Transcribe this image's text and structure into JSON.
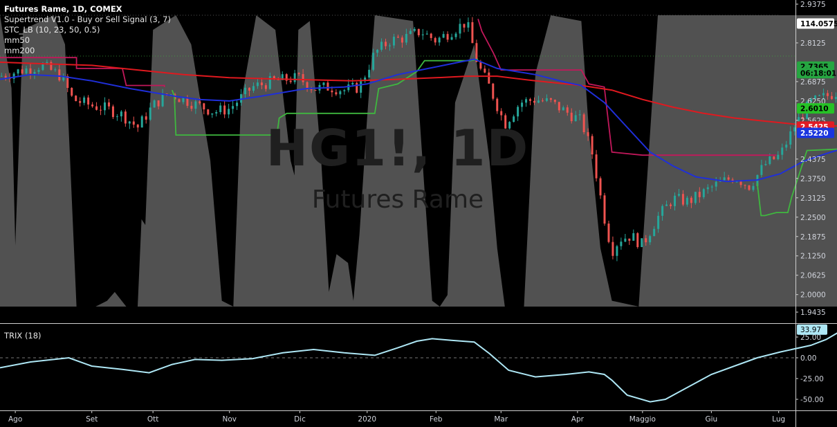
{
  "header": {
    "symbol_line": "Futures Rame, 1D, COMEX",
    "indicators": [
      "Supertrend V1.0 - Buy or Sell Signal (3, 7)",
      "STC_LB (10, 23, 50, 0.5)",
      "mm50",
      "mm200"
    ],
    "lower_indicator": "TRIX (18)"
  },
  "watermark": {
    "symbol": "HG1!, 1D",
    "description": "Futures Rame"
  },
  "price_axis": {
    "ticks": [
      "2.9375",
      "2.8125",
      "2.6875",
      "2.6250",
      "2.5625",
      "2.4375",
      "2.3750",
      "2.3125",
      "2.2500",
      "2.1875",
      "2.1250",
      "2.0625",
      "2.0000",
      "1.9435"
    ],
    "tick_values": [
      2.9375,
      2.8125,
      2.6875,
      2.625,
      2.5625,
      2.4375,
      2.375,
      2.3125,
      2.25,
      2.1875,
      2.125,
      2.0625,
      2.0,
      1.9435
    ],
    "badges": [
      {
        "label": "114.0575",
        "value": 2.875,
        "bg": "#ffffff",
        "fg": "#000000"
      },
      {
        "label": "2.7365",
        "value": 2.736,
        "bg": "#26a641",
        "fg": "#000000"
      },
      {
        "label": "06:18:01",
        "value": 2.715,
        "bg": "#26a641",
        "fg": "#000000"
      },
      {
        "label": "2.6010",
        "value": 2.601,
        "bg": "#26c226",
        "fg": "#000000"
      },
      {
        "label": "2.5425",
        "value": 2.5425,
        "bg": "#e01b24",
        "fg": "#ffffff"
      },
      {
        "label": "2.5220",
        "value": 2.522,
        "bg": "#1a35e0",
        "fg": "#ffffff"
      }
    ]
  },
  "trix_axis": {
    "ticks": [
      "25.00",
      "0.00",
      "-25.00",
      "-50.00"
    ],
    "tick_values": [
      25,
      0,
      -25,
      -50
    ],
    "badge": {
      "label": "33.97",
      "value": 33.97,
      "bg": "#aee7f5",
      "fg": "#000000"
    }
  },
  "time_axis": {
    "labels": [
      "Ago",
      "Set",
      "Ott",
      "Nov",
      "Dic",
      "2020",
      "Feb",
      "Mar",
      "Apr",
      "Maggio",
      "Giu",
      "Lug"
    ],
    "label_days": [
      20,
      120,
      200,
      300,
      392,
      480,
      570,
      655,
      755,
      840,
      930,
      1018
    ],
    "total_days": 1040
  },
  "colors": {
    "background": "#000000",
    "bull_candle": "#26a69a",
    "bear_candle": "#ef5350",
    "stc_fill": "#5a5a5a",
    "supertrend_up": "#3fb83f",
    "supertrend_down": "#c2185b",
    "mm50": "#1f2fd9",
    "mm200": "#e0191f",
    "trix": "#aee7f5"
  },
  "chart_data": {
    "type": "candlestick",
    "x_unit": "days from chart start",
    "price_close_path": [
      [
        0,
        2.705
      ],
      [
        30,
        2.725
      ],
      [
        55,
        2.74
      ],
      [
        80,
        2.705
      ],
      [
        95,
        2.63
      ],
      [
        120,
        2.61
      ],
      [
        140,
        2.6
      ],
      [
        160,
        2.58
      ],
      [
        180,
        2.54
      ],
      [
        200,
        2.61
      ],
      [
        220,
        2.65
      ],
      [
        250,
        2.62
      ],
      [
        280,
        2.59
      ],
      [
        300,
        2.6
      ],
      [
        330,
        2.67
      ],
      [
        360,
        2.69
      ],
      [
        390,
        2.7
      ],
      [
        410,
        2.665
      ],
      [
        430,
        2.67
      ],
      [
        450,
        2.66
      ],
      [
        470,
        2.67
      ],
      [
        490,
        2.78
      ],
      [
        510,
        2.82
      ],
      [
        530,
        2.83
      ],
      [
        550,
        2.85
      ],
      [
        570,
        2.82
      ],
      [
        590,
        2.85
      ],
      [
        610,
        2.88
      ],
      [
        625,
        2.74
      ],
      [
        640,
        2.67
      ],
      [
        660,
        2.55
      ],
      [
        680,
        2.62
      ],
      [
        700,
        2.63
      ],
      [
        720,
        2.62
      ],
      [
        740,
        2.59
      ],
      [
        760,
        2.56
      ],
      [
        775,
        2.45
      ],
      [
        790,
        2.25
      ],
      [
        800,
        2.14
      ],
      [
        810,
        2.18
      ],
      [
        825,
        2.19
      ],
      [
        840,
        2.16
      ],
      [
        860,
        2.25
      ],
      [
        880,
        2.31
      ],
      [
        900,
        2.3
      ],
      [
        920,
        2.33
      ],
      [
        940,
        2.36
      ],
      [
        960,
        2.38
      ],
      [
        980,
        2.35
      ],
      [
        1000,
        2.42
      ],
      [
        1020,
        2.45
      ],
      [
        1040,
        2.55
      ],
      [
        1060,
        2.62
      ],
      [
        1080,
        2.64
      ],
      [
        1100,
        2.66
      ],
      [
        1120,
        2.7365
      ]
    ],
    "stc_values": [
      [
        0,
        100
      ],
      [
        15,
        75
      ],
      [
        20,
        21
      ],
      [
        30,
        95
      ],
      [
        70,
        100
      ],
      [
        85,
        90
      ],
      [
        100,
        0
      ],
      [
        125,
        0
      ],
      [
        140,
        2
      ],
      [
        150,
        5
      ],
      [
        165,
        0
      ],
      [
        180,
        0
      ],
      [
        185,
        30
      ],
      [
        190,
        28
      ],
      [
        200,
        95
      ],
      [
        230,
        100
      ],
      [
        250,
        90
      ],
      [
        275,
        50
      ],
      [
        290,
        2
      ],
      [
        305,
        0
      ],
      [
        315,
        70
      ],
      [
        335,
        100
      ],
      [
        360,
        95
      ],
      [
        380,
        50
      ],
      [
        385,
        45
      ],
      [
        390,
        95
      ],
      [
        405,
        98
      ],
      [
        420,
        50
      ],
      [
        430,
        5
      ],
      [
        440,
        18
      ],
      [
        455,
        15
      ],
      [
        462,
        2
      ],
      [
        470,
        25
      ],
      [
        480,
        65
      ],
      [
        490,
        100
      ],
      [
        540,
        98
      ],
      [
        555,
        40
      ],
      [
        565,
        2
      ],
      [
        575,
        0
      ],
      [
        585,
        4
      ],
      [
        595,
        70
      ],
      [
        620,
        90
      ],
      [
        640,
        50
      ],
      [
        650,
        20
      ],
      [
        660,
        0
      ],
      [
        685,
        0
      ],
      [
        700,
        80
      ],
      [
        720,
        100
      ],
      [
        760,
        98
      ],
      [
        770,
        60
      ],
      [
        785,
        20
      ],
      [
        800,
        2
      ],
      [
        835,
        0
      ],
      [
        860,
        100
      ],
      [
        1125,
        100
      ]
    ],
    "supertrend_segments": [
      {
        "dir": "down",
        "points": [
          [
            0,
            2.765
          ],
          [
            100,
            2.765
          ],
          [
            100,
            2.73
          ],
          [
            160,
            2.73
          ],
          [
            165,
            2.675
          ],
          [
            215,
            2.675
          ],
          [
            215,
            2.67
          ]
        ]
      },
      {
        "dir": "up",
        "points": [
          [
            225,
            2.66
          ],
          [
            228,
            2.64
          ],
          [
            230,
            2.515
          ],
          [
            362,
            2.515
          ],
          [
            365,
            2.57
          ],
          [
            375,
            2.585
          ],
          [
            490,
            2.585
          ],
          [
            495,
            2.665
          ],
          [
            520,
            2.68
          ],
          [
            545,
            2.72
          ],
          [
            555,
            2.755
          ],
          [
            615,
            2.755
          ],
          [
            625,
            2.76
          ]
        ]
      },
      {
        "dir": "down",
        "points": [
          [
            625,
            2.89
          ],
          [
            630,
            2.85
          ],
          [
            645,
            2.78
          ],
          [
            655,
            2.725
          ],
          [
            760,
            2.725
          ],
          [
            770,
            2.68
          ],
          [
            790,
            2.67
          ],
          [
            800,
            2.46
          ],
          [
            840,
            2.45
          ],
          [
            1015,
            2.45
          ]
        ]
      },
      {
        "dir": "up",
        "points": [
          [
            990,
            2.36
          ],
          [
            995,
            2.255
          ],
          [
            1000,
            2.255
          ],
          [
            1015,
            2.265
          ],
          [
            1030,
            2.265
          ],
          [
            1035,
            2.315
          ],
          [
            1055,
            2.465
          ],
          [
            1100,
            2.47
          ],
          [
            1112,
            2.49
          ],
          [
            1125,
            2.6
          ]
        ]
      }
    ],
    "mm50": [
      [
        0,
        2.695
      ],
      [
        40,
        2.71
      ],
      [
        80,
        2.705
      ],
      [
        120,
        2.69
      ],
      [
        170,
        2.665
      ],
      [
        230,
        2.64
      ],
      [
        260,
        2.63
      ],
      [
        300,
        2.625
      ],
      [
        340,
        2.64
      ],
      [
        400,
        2.665
      ],
      [
        450,
        2.67
      ],
      [
        480,
        2.68
      ],
      [
        520,
        2.71
      ],
      [
        560,
        2.73
      ],
      [
        600,
        2.75
      ],
      [
        620,
        2.76
      ],
      [
        650,
        2.73
      ],
      [
        700,
        2.71
      ],
      [
        740,
        2.685
      ],
      [
        760,
        2.675
      ],
      [
        790,
        2.62
      ],
      [
        820,
        2.54
      ],
      [
        850,
        2.46
      ],
      [
        880,
        2.415
      ],
      [
        910,
        2.38
      ],
      [
        950,
        2.365
      ],
      [
        990,
        2.37
      ],
      [
        1020,
        2.39
      ],
      [
        1050,
        2.43
      ],
      [
        1080,
        2.455
      ],
      [
        1100,
        2.47
      ],
      [
        1125,
        2.522
      ]
    ],
    "mm200": [
      [
        0,
        2.75
      ],
      [
        60,
        2.745
      ],
      [
        120,
        2.74
      ],
      [
        180,
        2.725
      ],
      [
        240,
        2.71
      ],
      [
        300,
        2.7
      ],
      [
        380,
        2.695
      ],
      [
        460,
        2.69
      ],
      [
        520,
        2.695
      ],
      [
        570,
        2.7
      ],
      [
        610,
        2.705
      ],
      [
        650,
        2.705
      ],
      [
        700,
        2.69
      ],
      [
        760,
        2.675
      ],
      [
        800,
        2.66
      ],
      [
        840,
        2.63
      ],
      [
        880,
        2.605
      ],
      [
        920,
        2.585
      ],
      [
        960,
        2.57
      ],
      [
        1000,
        2.56
      ],
      [
        1040,
        2.55
      ],
      [
        1080,
        2.545
      ],
      [
        1125,
        2.5425
      ]
    ],
    "trix": [
      [
        0,
        -12
      ],
      [
        40,
        -5
      ],
      [
        90,
        0
      ],
      [
        120,
        -10
      ],
      [
        160,
        -14
      ],
      [
        195,
        -18
      ],
      [
        225,
        -8
      ],
      [
        255,
        -2
      ],
      [
        290,
        -3
      ],
      [
        330,
        -1
      ],
      [
        370,
        6
      ],
      [
        410,
        10
      ],
      [
        450,
        6
      ],
      [
        490,
        3
      ],
      [
        520,
        12
      ],
      [
        545,
        20
      ],
      [
        565,
        23
      ],
      [
        590,
        21
      ],
      [
        620,
        19
      ],
      [
        640,
        5
      ],
      [
        665,
        -15
      ],
      [
        700,
        -23
      ],
      [
        740,
        -20
      ],
      [
        770,
        -17
      ],
      [
        790,
        -20
      ],
      [
        800,
        -27
      ],
      [
        820,
        -45
      ],
      [
        850,
        -53
      ],
      [
        870,
        -50
      ],
      [
        890,
        -40
      ],
      [
        910,
        -30
      ],
      [
        930,
        -20
      ],
      [
        960,
        -10
      ],
      [
        990,
        0
      ],
      [
        1020,
        7
      ],
      [
        1060,
        15
      ],
      [
        1080,
        22
      ],
      [
        1095,
        30
      ],
      [
        1125,
        33.97
      ]
    ],
    "ylim_price": [
      1.9435,
      2.9375
    ],
    "ylim_trix": [
      -60,
      40
    ]
  }
}
